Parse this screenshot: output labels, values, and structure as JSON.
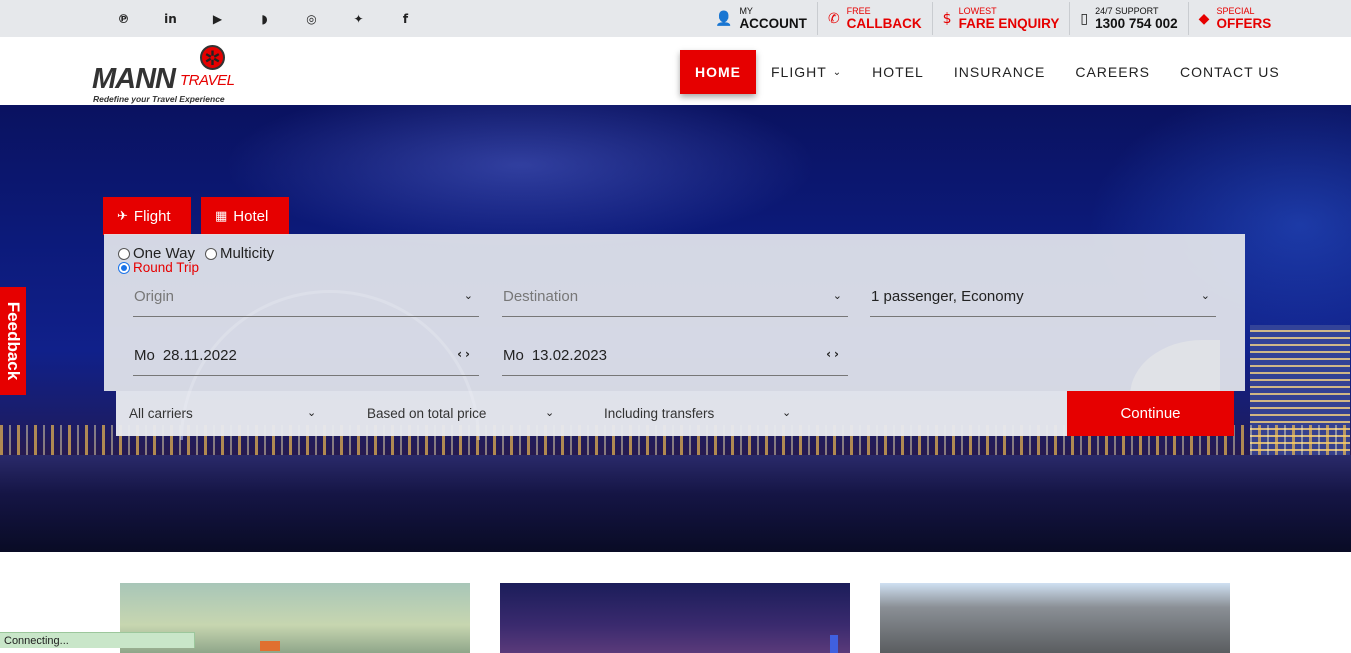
{
  "topbar": {
    "social": [
      {
        "icon": "pinterest-icon",
        "glyph": "℗"
      },
      {
        "icon": "linkedin-icon",
        "glyph": "in"
      },
      {
        "icon": "youtube-icon",
        "glyph": "▶"
      },
      {
        "icon": "rss-icon",
        "glyph": "◗"
      },
      {
        "icon": "instagram-icon",
        "glyph": "◎"
      },
      {
        "icon": "twitter-icon",
        "glyph": "✦"
      },
      {
        "icon": "facebook-icon",
        "glyph": "f"
      }
    ],
    "account": {
      "small": "MY",
      "big": "ACCOUNT",
      "icon": "user-icon"
    },
    "callback": {
      "small": "FREE",
      "big": "CALLBACK",
      "icon": "phone-icon"
    },
    "fare": {
      "small": "LOWEST",
      "big": "FARE ENQUIRY",
      "icon": "dollar-icon"
    },
    "support": {
      "small": "24/7 SUPPORT",
      "big": "1300 754 002",
      "icon": "mobile-icon"
    },
    "offers": {
      "small": "SPECIAL",
      "big": "OFFERS",
      "icon": "tag-icon"
    }
  },
  "logo": {
    "mann": "MANN",
    "travel": "TRAVEL",
    "tagline": "Redefine your Travel Experience"
  },
  "nav": {
    "home": "HOME",
    "flight": "FLIGHT",
    "hotel": "HOTEL",
    "insurance": "INSURANCE",
    "careers": "CAREERS",
    "contact": "CONTACT US"
  },
  "feedback": "Feedback",
  "search": {
    "tabs": {
      "flight": "Flight",
      "hotel": "Hotel"
    },
    "trip_types": {
      "one_way": "One Way",
      "round_trip": "Round Trip",
      "multicity": "Multicity",
      "selected": "Round Trip"
    },
    "origin_placeholder": "Origin",
    "destination_placeholder": "Destination",
    "passengers": "1 passenger, Economy",
    "depart": {
      "dow": "Mo",
      "date": "28.11.2022"
    },
    "return": {
      "dow": "Mo",
      "date": "13.02.2023"
    },
    "carriers": "All carriers",
    "price": "Based on total price",
    "transfers": "Including transfers",
    "continue": "Continue"
  },
  "status": "Connecting...",
  "colors": {
    "accent": "#e60000",
    "topbar": "#e6e8eb"
  }
}
